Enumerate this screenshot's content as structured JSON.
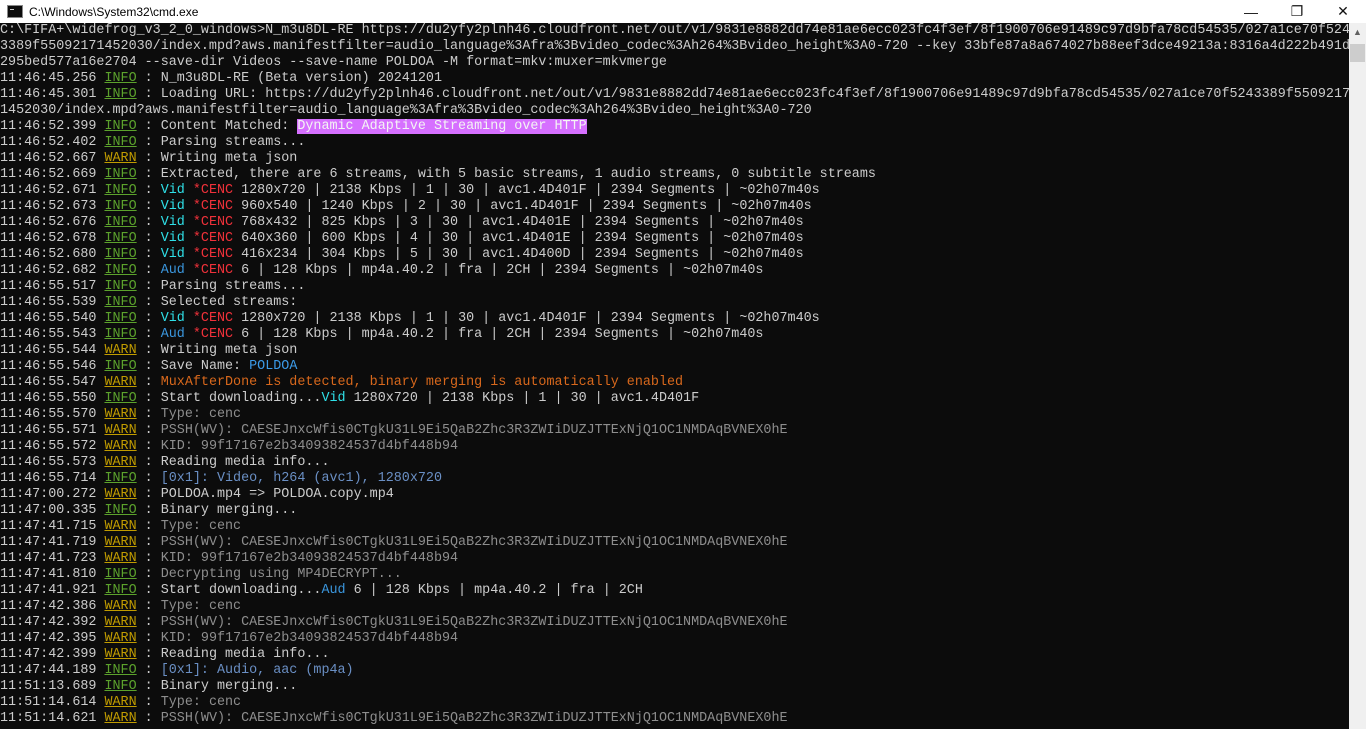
{
  "window": {
    "title": "C:\\Windows\\System32\\cmd.exe",
    "minimize": "—",
    "maximize": "❐",
    "close": "✕"
  },
  "colors": {
    "info": "#5ca22c",
    "warn": "#c19c00",
    "vid": "#2fe0e8",
    "aud": "#3a96dd",
    "cenc": "#f0313a",
    "highlight": "#d670ff"
  },
  "command_lines": [
    "C:\\FIFA+\\widefrog_v3_2_0_windows>N_m3u8DL-RE https://du2yfy2plnh46.cloudfront.net/out/v1/9831e8882dd74e81ae6ecc023fc4f3ef/8f1900706e91489c97d9bfa78cd54535/027a1ce70f524",
    "3389f55092171452030/index.mpd?aws.manifestfilter=audio_language%3Afra%3Bvideo_codec%3Ah264%3Bvideo_height%3A0-720 --key 33bfe87a8a674027b88eef3dce49213a:8316a4d222b491d",
    "295bed577a16e2704 --save-dir Videos --save-name POLDOA -M format=mkv:muxer=mkvmerge"
  ],
  "log": [
    {
      "time": "11:46:45.256",
      "level": "INFO",
      "segs": [
        [
          "N_m3u8DL-RE (Beta version) 20241201",
          ""
        ]
      ]
    },
    {
      "time": "11:46:45.301",
      "level": "INFO",
      "segs": [
        [
          "Loading URL: https://du2yfy2plnh46.cloudfront.net/out/v1/9831e8882dd74e81ae6ecc023fc4f3ef/8f1900706e91489c97d9bfa78cd54535/027a1ce70f5243389f5509217",
          ""
        ]
      ]
    },
    {
      "cont": "1452030/index.mpd?aws.manifestfilter=audio_language%3Afra%3Bvideo_codec%3Ah264%3Bvideo_height%3A0-720"
    },
    {
      "time": "11:46:52.399",
      "level": "INFO",
      "segs": [
        [
          "Content Matched: ",
          ""
        ],
        [
          "Dynamic Adaptive Streaming over HTTP",
          "hl"
        ]
      ]
    },
    {
      "time": "11:46:52.402",
      "level": "INFO",
      "segs": [
        [
          "Parsing streams...",
          ""
        ]
      ]
    },
    {
      "time": "11:46:52.667",
      "level": "WARN",
      "segs": [
        [
          "Writing meta json",
          ""
        ]
      ]
    },
    {
      "time": "11:46:52.669",
      "level": "INFO",
      "segs": [
        [
          "Extracted, there are 6 streams, with 5 basic streams, 1 audio streams, 0 subtitle streams",
          ""
        ]
      ]
    },
    {
      "time": "11:46:52.671",
      "level": "INFO",
      "segs": [
        [
          "Vid ",
          "vid"
        ],
        [
          "*CENC ",
          "cenc"
        ],
        [
          "1280x720 | 2138 Kbps | 1 | 30 | avc1.4D401F | 2394 Segments | ~02h07m40s",
          ""
        ]
      ]
    },
    {
      "time": "11:46:52.673",
      "level": "INFO",
      "segs": [
        [
          "Vid ",
          "vid"
        ],
        [
          "*CENC ",
          "cenc"
        ],
        [
          "960x540 | 1240 Kbps | 2 | 30 | avc1.4D401F | 2394 Segments | ~02h07m40s",
          ""
        ]
      ]
    },
    {
      "time": "11:46:52.676",
      "level": "INFO",
      "segs": [
        [
          "Vid ",
          "vid"
        ],
        [
          "*CENC ",
          "cenc"
        ],
        [
          "768x432 | 825 Kbps | 3 | 30 | avc1.4D401E | 2394 Segments | ~02h07m40s",
          ""
        ]
      ]
    },
    {
      "time": "11:46:52.678",
      "level": "INFO",
      "segs": [
        [
          "Vid ",
          "vid"
        ],
        [
          "*CENC ",
          "cenc"
        ],
        [
          "640x360 | 600 Kbps | 4 | 30 | avc1.4D401E | 2394 Segments | ~02h07m40s",
          ""
        ]
      ]
    },
    {
      "time": "11:46:52.680",
      "level": "INFO",
      "segs": [
        [
          "Vid ",
          "vid"
        ],
        [
          "*CENC ",
          "cenc"
        ],
        [
          "416x234 | 304 Kbps | 5 | 30 | avc1.4D400D | 2394 Segments | ~02h07m40s",
          ""
        ]
      ]
    },
    {
      "time": "11:46:52.682",
      "level": "INFO",
      "segs": [
        [
          "Aud ",
          "aud"
        ],
        [
          "*CENC ",
          "cenc"
        ],
        [
          "6 | 128 Kbps | mp4a.40.2 | fra | 2CH | 2394 Segments | ~02h07m40s",
          ""
        ]
      ]
    },
    {
      "time": "11:46:55.517",
      "level": "INFO",
      "segs": [
        [
          "Parsing streams...",
          ""
        ]
      ]
    },
    {
      "time": "11:46:55.539",
      "level": "INFO",
      "segs": [
        [
          "Selected streams:",
          ""
        ]
      ]
    },
    {
      "time": "11:46:55.540",
      "level": "INFO",
      "segs": [
        [
          "Vid ",
          "vid"
        ],
        [
          "*CENC ",
          "cenc"
        ],
        [
          "1280x720 | 2138 Kbps | 1 | 30 | avc1.4D401F | 2394 Segments | ~02h07m40s",
          ""
        ]
      ]
    },
    {
      "time": "11:46:55.543",
      "level": "INFO",
      "segs": [
        [
          "Aud ",
          "aud"
        ],
        [
          "*CENC ",
          "cenc"
        ],
        [
          "6 | 128 Kbps | mp4a.40.2 | fra | 2CH | 2394 Segments | ~02h07m40s",
          ""
        ]
      ]
    },
    {
      "time": "11:46:55.544",
      "level": "WARN",
      "segs": [
        [
          "Writing meta json",
          ""
        ]
      ]
    },
    {
      "time": "11:46:55.546",
      "level": "INFO",
      "segs": [
        [
          "Save Name: ",
          ""
        ],
        [
          "POLDOA",
          "blue"
        ]
      ]
    },
    {
      "time": "11:46:55.547",
      "level": "WARN",
      "segs": [
        [
          "MuxAfterDone is detected, binary merging is automatically enabled",
          "orange"
        ]
      ]
    },
    {
      "time": "11:46:55.550",
      "level": "INFO",
      "segs": [
        [
          "Start downloading...",
          ""
        ],
        [
          "Vid",
          "vid"
        ],
        [
          " 1280x720 | 2138 Kbps | 1 | 30 | avc1.4D401F",
          ""
        ]
      ]
    },
    {
      "time": "11:46:55.570",
      "level": "WARN",
      "segs": [
        [
          "Type: cenc",
          "gray"
        ]
      ]
    },
    {
      "time": "11:46:55.571",
      "level": "WARN",
      "segs": [
        [
          "PSSH(WV): CAESEJnxcWfis0CTgkU31L9Ei5QaB2Zhc3R3ZWIiDUZJTTExNjQ1OC1NMDAqBVNEX0hE",
          "gray"
        ]
      ]
    },
    {
      "time": "11:46:55.572",
      "level": "WARN",
      "segs": [
        [
          "KID: 99f17167e2b34093824537d4bf448b94",
          "gray"
        ]
      ]
    },
    {
      "time": "11:46:55.573",
      "level": "WARN",
      "segs": [
        [
          "Reading media info...",
          ""
        ]
      ]
    },
    {
      "time": "11:46:55.714",
      "level": "INFO",
      "segs": [
        [
          "[0x1]: Video, h264 (avc1), 1280x720",
          "steel"
        ]
      ]
    },
    {
      "time": "11:47:00.272",
      "level": "WARN",
      "segs": [
        [
          "POLDOA.mp4 => POLDOA.copy.mp4",
          ""
        ]
      ]
    },
    {
      "time": "11:47:00.335",
      "level": "INFO",
      "segs": [
        [
          "Binary merging...",
          ""
        ]
      ]
    },
    {
      "time": "11:47:41.715",
      "level": "WARN",
      "segs": [
        [
          "Type: cenc",
          "gray"
        ]
      ]
    },
    {
      "time": "11:47:41.719",
      "level": "WARN",
      "segs": [
        [
          "PSSH(WV): CAESEJnxcWfis0CTgkU31L9Ei5QaB2Zhc3R3ZWIiDUZJTTExNjQ1OC1NMDAqBVNEX0hE",
          "gray"
        ]
      ]
    },
    {
      "time": "11:47:41.723",
      "level": "WARN",
      "segs": [
        [
          "KID: 99f17167e2b34093824537d4bf448b94",
          "gray"
        ]
      ]
    },
    {
      "time": "11:47:41.810",
      "level": "INFO",
      "segs": [
        [
          "Decrypting using MP4DECRYPT...",
          "gray"
        ]
      ]
    },
    {
      "time": "11:47:41.921",
      "level": "INFO",
      "segs": [
        [
          "Start downloading...",
          ""
        ],
        [
          "Aud",
          "aud"
        ],
        [
          " 6 | 128 Kbps | mp4a.40.2 | fra | 2CH",
          ""
        ]
      ]
    },
    {
      "time": "11:47:42.386",
      "level": "WARN",
      "segs": [
        [
          "Type: cenc",
          "gray"
        ]
      ]
    },
    {
      "time": "11:47:42.392",
      "level": "WARN",
      "segs": [
        [
          "PSSH(WV): CAESEJnxcWfis0CTgkU31L9Ei5QaB2Zhc3R3ZWIiDUZJTTExNjQ1OC1NMDAqBVNEX0hE",
          "gray"
        ]
      ]
    },
    {
      "time": "11:47:42.395",
      "level": "WARN",
      "segs": [
        [
          "KID: 99f17167e2b34093824537d4bf448b94",
          "gray"
        ]
      ]
    },
    {
      "time": "11:47:42.399",
      "level": "WARN",
      "segs": [
        [
          "Reading media info...",
          ""
        ]
      ]
    },
    {
      "time": "11:47:44.189",
      "level": "INFO",
      "segs": [
        [
          "[0x1]: Audio, aac (mp4a)",
          "steel"
        ]
      ]
    },
    {
      "time": "11:51:13.689",
      "level": "INFO",
      "segs": [
        [
          "Binary merging...",
          ""
        ]
      ]
    },
    {
      "time": "11:51:14.614",
      "level": "WARN",
      "segs": [
        [
          "Type: cenc",
          "gray"
        ]
      ]
    },
    {
      "time": "11:51:14.621",
      "level": "WARN",
      "segs": [
        [
          "PSSH(WV): CAESEJnxcWfis0CTgkU31L9Ei5QaB2Zhc3R3ZWIiDUZJTTExNjQ1OC1NMDAqBVNEX0hE",
          "gray"
        ]
      ]
    }
  ],
  "separator": " : "
}
